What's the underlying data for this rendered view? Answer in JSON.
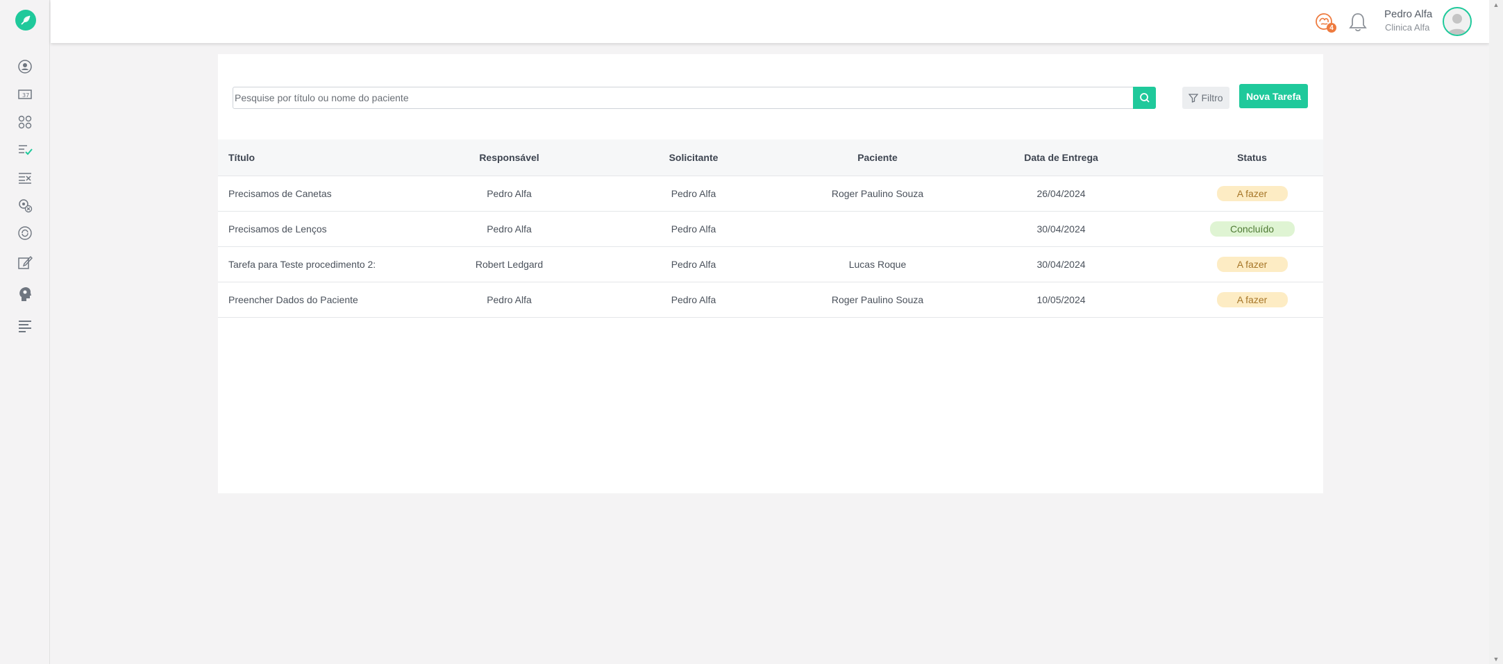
{
  "sidebar": {
    "items": [
      {
        "icon": "user-circle-icon"
      },
      {
        "icon": "calendar-icon"
      },
      {
        "icon": "grid-icon"
      },
      {
        "icon": "task-list-check-icon"
      },
      {
        "icon": "task-list-cancel-icon"
      },
      {
        "icon": "settings-cancel-icon"
      },
      {
        "icon": "refresh-icon"
      },
      {
        "icon": "edit-document-icon"
      },
      {
        "icon": "head-icon"
      },
      {
        "icon": "menu-lines-icon"
      }
    ]
  },
  "topbar": {
    "notification_badge": "4",
    "user_name": "Pedro Alfa",
    "clinic_name": "Clinica Alfa"
  },
  "toolbar": {
    "search_placeholder": "Pesquise por título ou nome do paciente",
    "filter_label": "Filtro",
    "new_task_label": "Nova Tarefa"
  },
  "table": {
    "headers": [
      "Título",
      "Responsável",
      "Solicitante",
      "Paciente",
      "Data de Entrega",
      "Status"
    ],
    "rows": [
      {
        "titulo": "Precisamos de Canetas",
        "responsavel": "Pedro Alfa",
        "solicitante": "Pedro Alfa",
        "paciente": "Roger Paulino Souza",
        "data": "26/04/2024",
        "status": "A fazer"
      },
      {
        "titulo": "Precisamos de Lenços",
        "responsavel": "Pedro Alfa",
        "solicitante": "Pedro Alfa",
        "paciente": "",
        "data": "30/04/2024",
        "status": "Concluído"
      },
      {
        "titulo": "Tarefa para Teste procedimento 2:",
        "responsavel": "Robert Ledgard",
        "solicitante": "Pedro Alfa",
        "paciente": "Lucas Roque",
        "data": "30/04/2024",
        "status": "A fazer"
      },
      {
        "titulo": "Preencher Dados do Paciente",
        "responsavel": "Pedro Alfa",
        "solicitante": "Pedro Alfa",
        "paciente": "Roger Paulino Souza",
        "data": "10/05/2024",
        "status": "A fazer"
      }
    ]
  },
  "colors": {
    "accent": "#1fc99b",
    "badge": "#ee7b3f",
    "status_todo_bg": "#fdecc4",
    "status_done_bg": "#dff4d3"
  }
}
